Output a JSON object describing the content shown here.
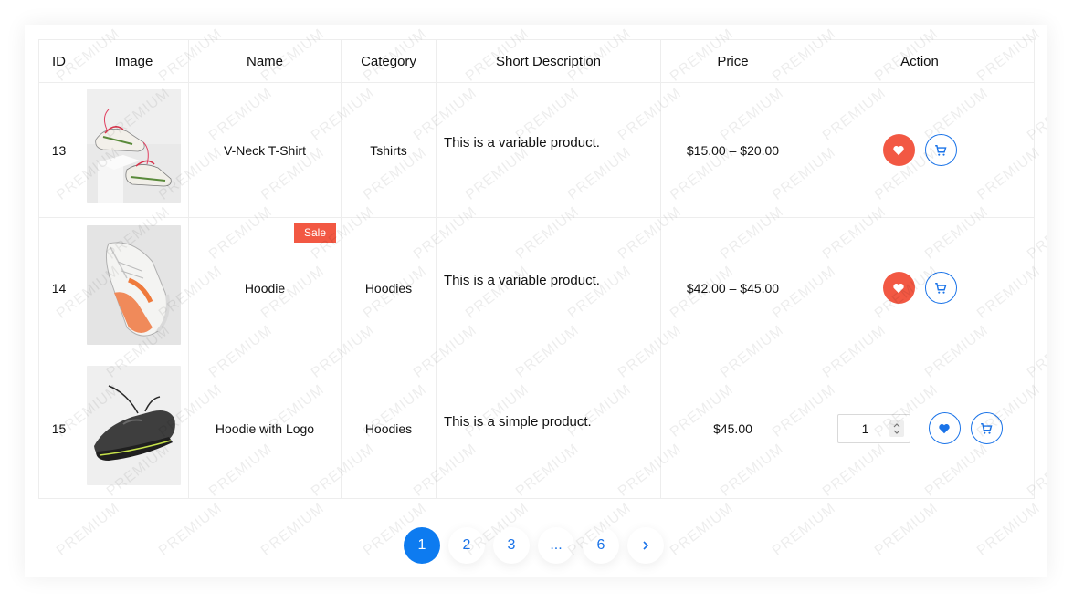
{
  "table": {
    "headers": [
      "ID",
      "Image",
      "Name",
      "Category",
      "Short Description",
      "Price",
      "Action"
    ],
    "rows": [
      {
        "id": "13",
        "name": "V-Neck T-Shirt",
        "category": "Tshirts",
        "description": "This is a variable product.",
        "price": "$15.00 – $20.00",
        "badge": "",
        "image_icon": "sneaker-image"
      },
      {
        "id": "14",
        "name": "Hoodie",
        "category": "Hoodies",
        "description": "This is a variable product.",
        "price": "$42.00 – $45.00",
        "badge": "Sale",
        "image_icon": "sneaker-image"
      },
      {
        "id": "15",
        "name": "Hoodie with Logo",
        "category": "Hoodies",
        "description": "This is a simple product.",
        "price": "$45.00",
        "badge": "",
        "image_icon": "sneaker-image",
        "quantity": "1"
      }
    ]
  },
  "pagination": {
    "pages": [
      "1",
      "2",
      "3",
      "...",
      "6"
    ],
    "active": "1",
    "next_icon": "chevron-right-icon"
  },
  "watermark": "PREMIUM",
  "colors": {
    "accent": "#1a73e8",
    "active_page": "#0d7bf0",
    "wishlist": "#f25843",
    "sale": "#f25843"
  }
}
